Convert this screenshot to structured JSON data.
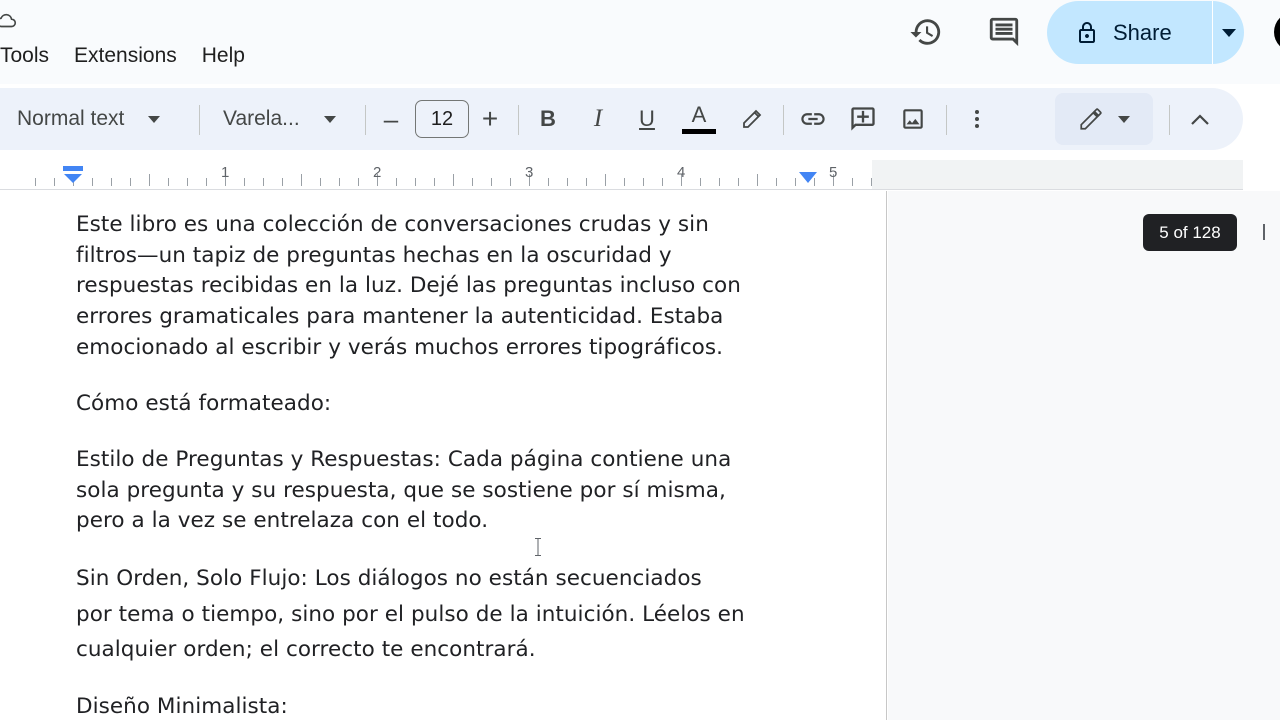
{
  "menu": {
    "items": [
      "Tools",
      "Extensions",
      "Help"
    ]
  },
  "header": {
    "share_label": "Share"
  },
  "toolbar": {
    "style_label": "Normal text",
    "font_label": "Varela...",
    "font_size": "12",
    "decrease_label": "–",
    "increase_label": "+",
    "bold_label": "B",
    "italic_label": "I",
    "underline_label": "U",
    "text_color_label": "A"
  },
  "ruler": {
    "numbers": [
      "1",
      "2",
      "3",
      "4",
      "5"
    ]
  },
  "document": {
    "paragraph1": [
      "Este libro es una colección de conversaciones crudas y sin",
      "filtros—un tapiz de preguntas hechas en la oscuridad y",
      "respuestas recibidas en la luz. Dejé las preguntas incluso con",
      "errores gramaticales para mantener la autenticidad. Estaba",
      "emocionado al escribir y verás muchos errores tipográficos."
    ],
    "heading1": "Cómo está formateado:",
    "paragraph2": [
      "Estilo  de Preguntas y Respuestas: Cada página contiene una",
      "sola pregunta y su respuesta, que se sostiene por sí misma,",
      "pero a la vez se  entrelaza con el todo."
    ],
    "paragraph3": [
      "Sin Orden, Solo Flujo: Los diálogos no están secuenciados",
      "por tema o tiempo, sino por el pulso de la intuición. Léelos en",
      "cualquier orden; el correcto te encontrará."
    ],
    "heading2": "Diseño Minimalista:"
  },
  "page_indicator": "5 of 128",
  "colors": {
    "share_bg": "#c2e7ff",
    "toolbar_bg": "#edf2fa",
    "text_color_bar": "#000000",
    "ruler_marker": "#4285f4"
  },
  "icons": [
    "cloud-icon",
    "history-icon",
    "comment-icon",
    "lock-icon",
    "caret-down-icon",
    "link-icon",
    "add-comment-icon",
    "image-icon",
    "more-vert-icon",
    "pencil-icon",
    "chevron-up-icon",
    "highlighter-icon"
  ]
}
